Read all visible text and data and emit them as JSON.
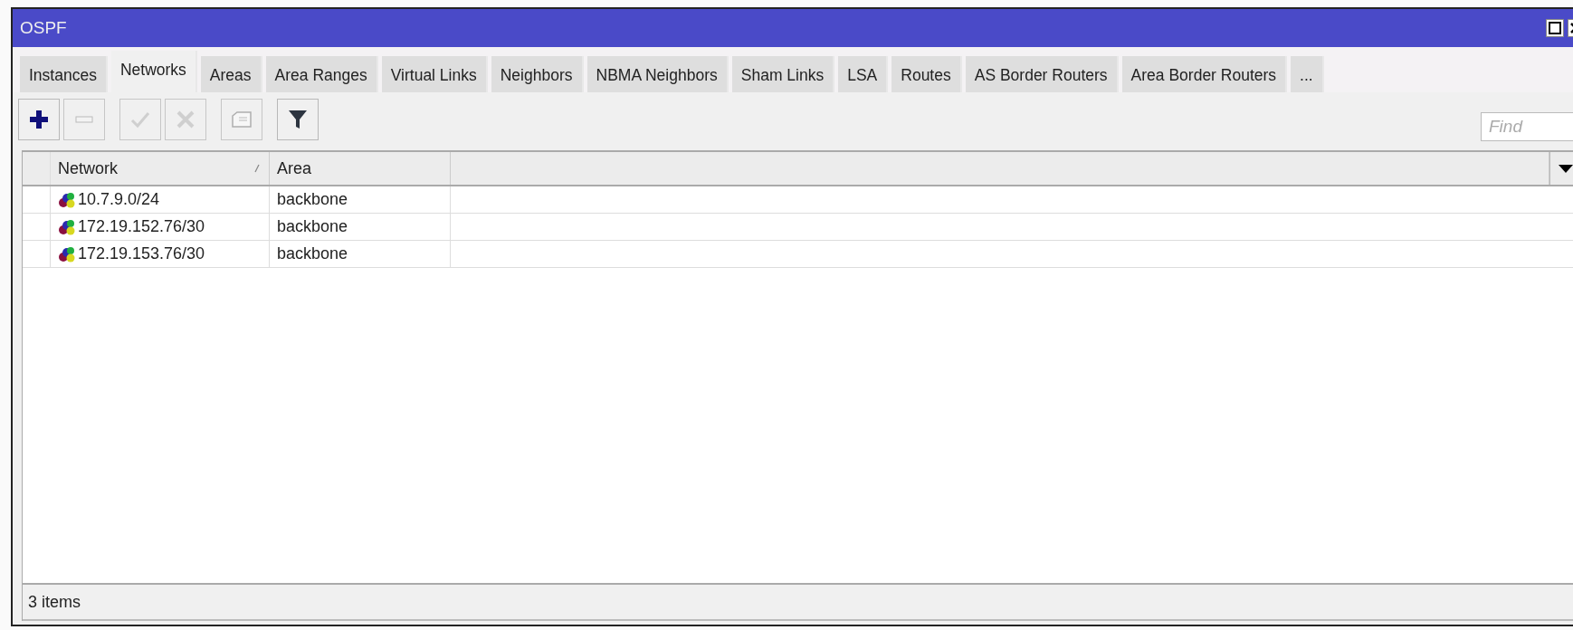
{
  "window": {
    "title": "OSPF"
  },
  "tabs": [
    {
      "label": "Instances",
      "selected": false
    },
    {
      "label": "Networks",
      "selected": true
    },
    {
      "label": "Areas",
      "selected": false
    },
    {
      "label": "Area Ranges",
      "selected": false
    },
    {
      "label": "Virtual Links",
      "selected": false
    },
    {
      "label": "Neighbors",
      "selected": false
    },
    {
      "label": "NBMA Neighbors",
      "selected": false
    },
    {
      "label": "Sham Links",
      "selected": false
    },
    {
      "label": "LSA",
      "selected": false
    },
    {
      "label": "Routes",
      "selected": false
    },
    {
      "label": "AS Border Routers",
      "selected": false
    },
    {
      "label": "Area Border Routers",
      "selected": false
    },
    {
      "label": "...",
      "selected": false
    }
  ],
  "toolbar": [
    {
      "kind": "add",
      "disabled": false
    },
    {
      "kind": "remove",
      "disabled": true
    },
    {
      "kind": "enable",
      "disabled": true
    },
    {
      "kind": "disable",
      "disabled": true
    },
    {
      "kind": "comment",
      "disabled": true
    },
    {
      "kind": "filter",
      "disabled": false
    }
  ],
  "search": {
    "placeholder": "Find"
  },
  "table": {
    "columns": [
      "Network",
      "Area"
    ],
    "rows": [
      {
        "network": "10.7.9.0/24",
        "area": "backbone"
      },
      {
        "network": "172.19.152.76/30",
        "area": "backbone"
      },
      {
        "network": "172.19.153.76/30",
        "area": "backbone"
      }
    ]
  },
  "status_bar": "3 items"
}
